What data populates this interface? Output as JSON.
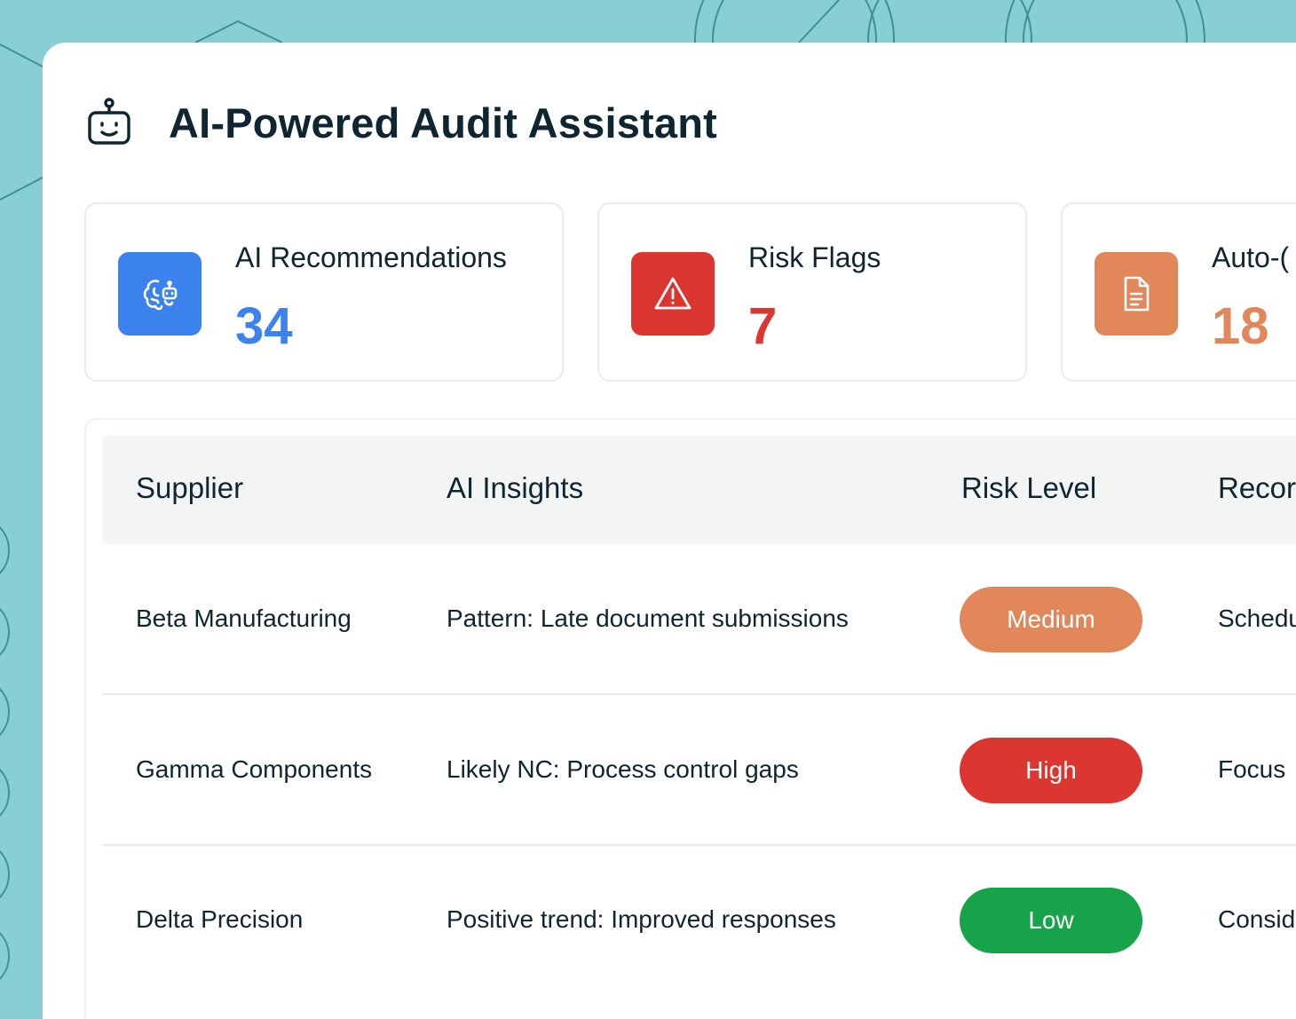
{
  "app": {
    "title": "AI-Powered Audit Assistant",
    "title_icon": "robot-icon"
  },
  "stats": [
    {
      "label": "AI Recommendations",
      "value": "34",
      "icon": "brain-icon",
      "color": "#3b82ef"
    },
    {
      "label": "Risk Flags",
      "value": "7",
      "icon": "warning-icon",
      "color": "#dc3631"
    },
    {
      "label": "Auto-(",
      "value": "18",
      "icon": "document-icon",
      "color": "#e2875a"
    }
  ],
  "table": {
    "headers": [
      "Supplier",
      "AI Insights",
      "Risk Level",
      "Recor"
    ],
    "rows": [
      {
        "supplier": "Beta Manufacturing",
        "insight": "Pattern: Late document submissions",
        "risk": "Medium",
        "risk_color": "#e2875a",
        "recommendation": "Schedu"
      },
      {
        "supplier": "Gamma Components",
        "insight": "Likely NC: Process control gaps",
        "risk": "High",
        "risk_color": "#dc3631",
        "recommendation": "Focus"
      },
      {
        "supplier": "Delta Precision",
        "insight": "Positive trend: Improved responses",
        "risk": "Low",
        "risk_color": "#16a34a",
        "recommendation": "Consid"
      }
    ]
  },
  "colors": {
    "background": "#88cfd4",
    "panel": "#ffffff",
    "text": "#0f2530"
  }
}
